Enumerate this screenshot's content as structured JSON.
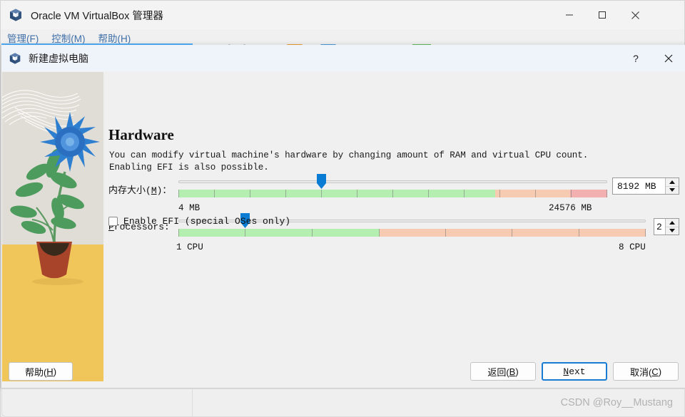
{
  "app": {
    "title": "Oracle VM VirtualBox 管理器",
    "icon": "virtualbox-cube-icon",
    "menu": [
      {
        "label": "管理(F)"
      },
      {
        "label": "控制(M)"
      },
      {
        "label": "帮助(H)"
      }
    ],
    "window_controls": {
      "minimize": "—",
      "maximize": "☐",
      "close": "✕"
    }
  },
  "dialog": {
    "title": "新建虚拟电脑",
    "icon": "virtualbox-cube-icon",
    "help_button": "?",
    "close_button": "✕",
    "page_title": "Hardware",
    "description": "You can modify virtual machine's hardware by changing amount of RAM and virtual CPU count. Enabling EFI is also possible.",
    "memory": {
      "label": "内存大小(M)：",
      "label_plain": "内存大小(",
      "label_mnemonic": "M",
      "label_tail": ")：",
      "min_text": "4 MB",
      "max_text": "24576 MB",
      "value_text": "8192 MB",
      "value": 8192,
      "min": 4,
      "max": 24576,
      "handle_percent": 33.2,
      "green_percent": 74.0,
      "orange_percent": 91.0
    },
    "processors": {
      "label": "Processors:",
      "label_mnemonic": "P",
      "label_tail": "rocessors:",
      "min_text": "1 CPU",
      "max_text": "8 CPU",
      "value_text": "2",
      "value": 2,
      "min": 1,
      "max": 8,
      "handle_percent": 14.8,
      "green_percent": 43.0
    },
    "efi": {
      "label_head": "E",
      "label_tail": "nable EFI (special OSes only)",
      "checked": false
    },
    "buttons": {
      "help": {
        "head": "帮助(",
        "mnemonic": "H",
        "tail": ")"
      },
      "back": {
        "head": "返回(",
        "mnemonic": "B",
        "tail": ")"
      },
      "next": {
        "head": "N",
        "mnemonic_is_head": true,
        "tail": "ext"
      },
      "cancel": {
        "head": "取消(",
        "mnemonic": "C",
        "tail": ")"
      }
    }
  },
  "watermark": "CSDN @Roy__Mustang",
  "colors": {
    "accent": "#1a7bd4",
    "slider_handle": "#0a7cd4",
    "zone_green": "#b5eeb1",
    "zone_orange": "#f6cbb2",
    "zone_red": "#f2b0b1",
    "dialog_titlebar": "#eff3fa",
    "art_sky": "#e0ddd6",
    "art_ground": "#f0c65a",
    "art_flower": "#2f7fd0",
    "art_pot": "#a8442a",
    "art_leaf": "#4e9b5e"
  }
}
